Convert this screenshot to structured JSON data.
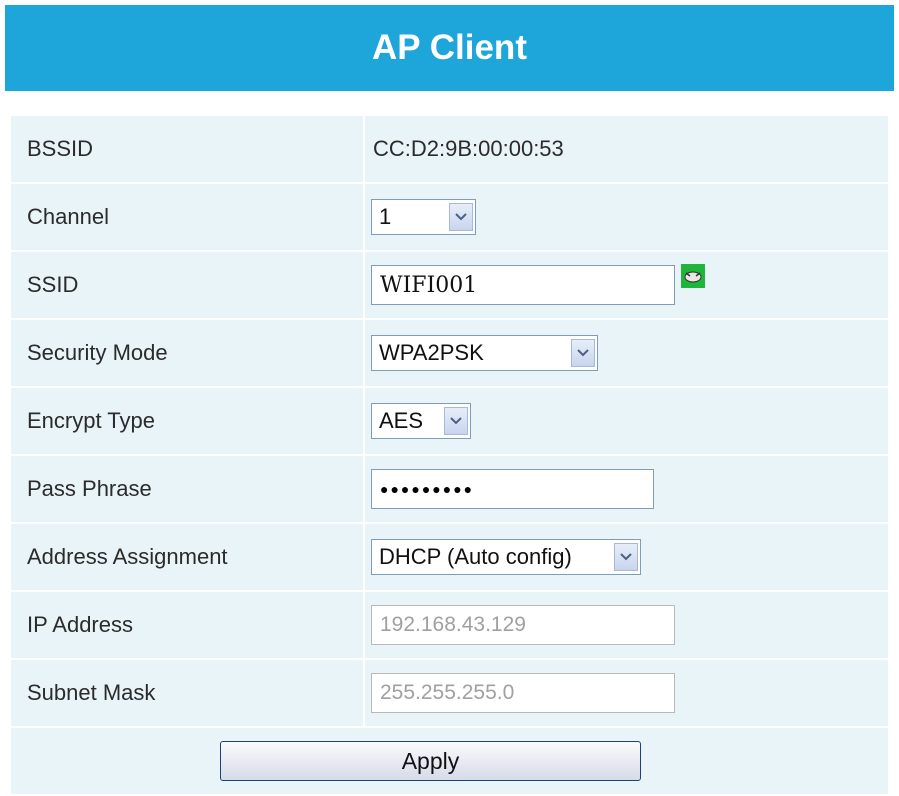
{
  "header": {
    "title": "AP Client"
  },
  "fields": {
    "bssid": {
      "label": "BSSID",
      "value": "CC:D2:9B:00:00:53"
    },
    "channel": {
      "label": "Channel",
      "value": "1"
    },
    "ssid": {
      "label": "SSID",
      "value": "WIFI001"
    },
    "security_mode": {
      "label": "Security Mode",
      "value": "WPA2PSK"
    },
    "encrypt_type": {
      "label": "Encrypt Type",
      "value": "AES"
    },
    "pass_phrase": {
      "label": "Pass Phrase",
      "value": "●●●●●●●●●"
    },
    "address_assignment": {
      "label": "Address Assignment",
      "value": "DHCP (Auto config)"
    },
    "ip_address": {
      "label": "IP Address",
      "value": "192.168.43.129"
    },
    "subnet_mask": {
      "label": "Subnet Mask",
      "value": "255.255.255.0"
    }
  },
  "actions": {
    "apply_label": "Apply"
  },
  "icons": {
    "dropdown": "chevron-down-icon",
    "scan": "scan-icon"
  },
  "colors": {
    "header_bg": "#1ea5da",
    "row_bg": "#e9f4f9",
    "scan_button": "#1eb53a"
  }
}
